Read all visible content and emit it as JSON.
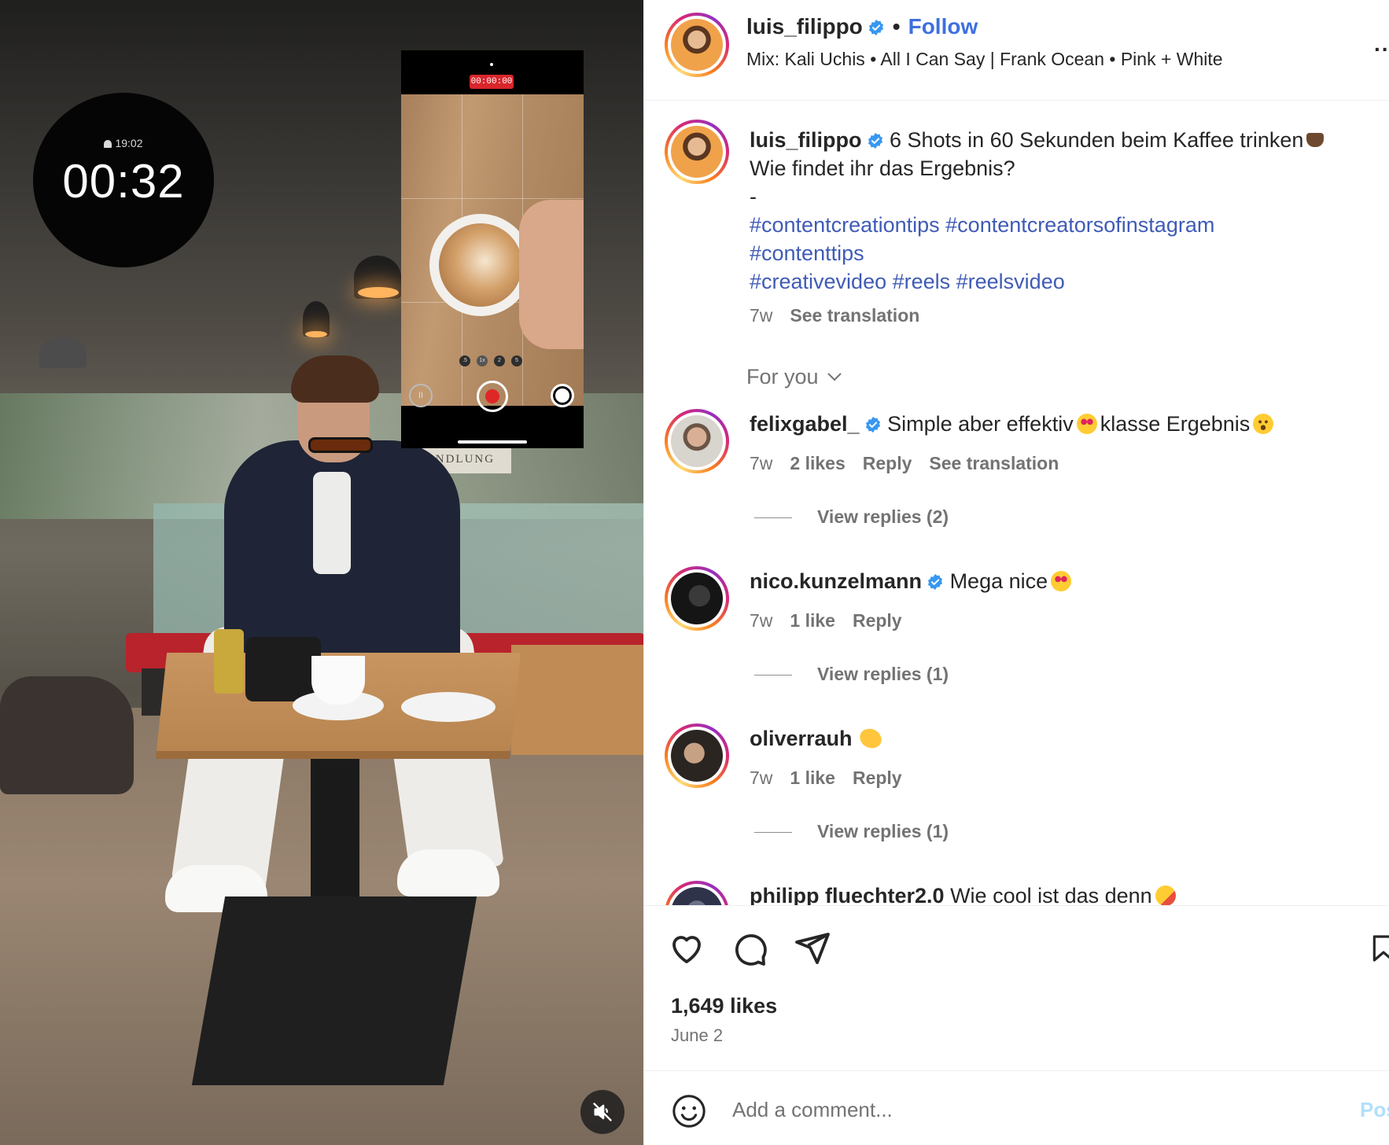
{
  "media": {
    "stopwatch": {
      "alarm": "19:02",
      "elapsed": "00:32"
    },
    "phone": {
      "rec_timer": "00:00:00",
      "zoom_levels": [
        ".5",
        "1x",
        "2",
        "5"
      ]
    },
    "wall_sign": "WEINHANDLUNG",
    "muted": true
  },
  "header": {
    "username": "luis_filippo",
    "separator": "•",
    "follow_label": "Follow",
    "audio": "Mix: Kali Uchis • All I Can Say | Frank Ocean • Pink + White",
    "more": "..."
  },
  "caption": {
    "username": "luis_filippo",
    "line1": "6 Shots in 60 Sekunden beim Kaffee trinken",
    "line2": "Wie findet ihr das Ergebnis?",
    "line3": "-",
    "hashtags_line1": "#contentcreationtips #contentcreatorsofinstagram",
    "hashtags_line2": "#contenttips",
    "hashtags_line3": "#creativevideo #reels #reelsvideo",
    "age": "7w",
    "see_translation": "See translation"
  },
  "for_you_label": "For you",
  "comments": [
    {
      "username": "felixgabel_",
      "text_a": "Simple aber effektiv",
      "text_b": "klasse Ergebnis",
      "age": "7w",
      "likes": "2 likes",
      "reply": "Reply",
      "see_translation": "See translation",
      "view_replies": "View replies (2)"
    },
    {
      "username": "nico.kunzelmann",
      "text": "Mega nice",
      "age": "7w",
      "likes": "1 like",
      "reply": "Reply",
      "view_replies": "View replies (1)"
    },
    {
      "username": "oliverrauh",
      "age": "7w",
      "likes": "1 like",
      "reply": "Reply",
      "view_replies": "View replies (1)"
    },
    {
      "username": "philipp fluechter2.0",
      "text": "Wie cool ist das denn"
    }
  ],
  "actions": {
    "icons": [
      "heart-icon",
      "comment-icon",
      "share-icon",
      "bookmark-icon"
    ],
    "likes": "1,649 likes",
    "date": "June 2"
  },
  "comment_bar": {
    "placeholder": "Add a comment...",
    "post_label": "Pos"
  },
  "colors": {
    "follow": "#3f6fe0",
    "hashtag": "#3f5bb5",
    "verified": "#3897f0",
    "muted_text": "#737373"
  }
}
